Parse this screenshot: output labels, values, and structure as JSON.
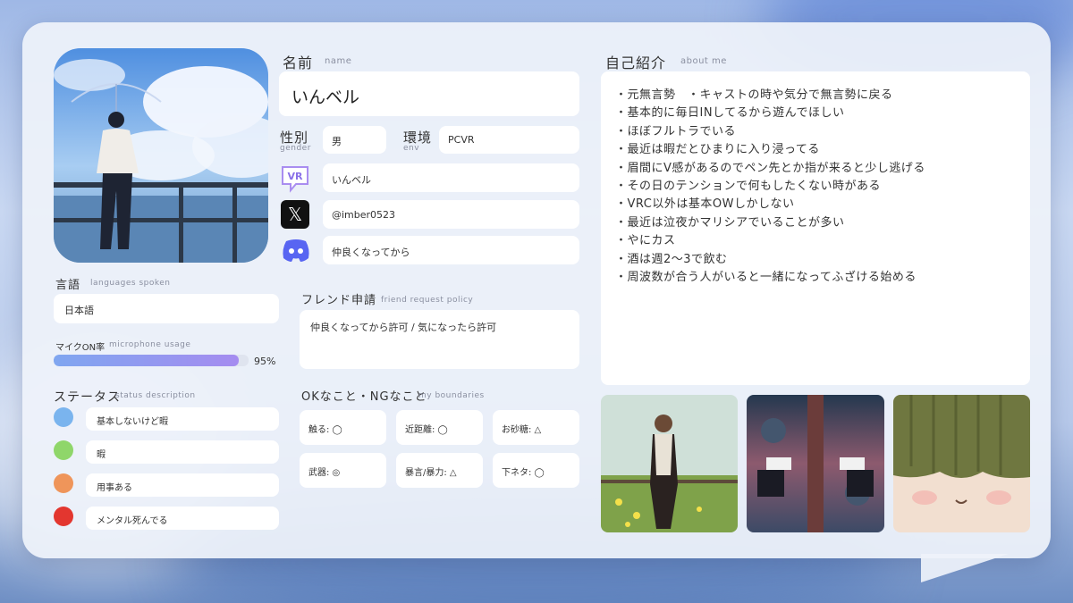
{
  "colors": {
    "status_1": "#7ab4ee",
    "status_2": "#8fd66a",
    "status_3": "#ef955a",
    "status_4": "#e3362f",
    "progress_start": "#7fa6f0",
    "progress_end": "#a58cf0"
  },
  "name": {
    "label_jp": "名前",
    "label_en": "name",
    "value": "いんベル"
  },
  "gender": {
    "label_jp": "性別",
    "label_en": "gender",
    "value": "男"
  },
  "env": {
    "label_jp": "環境",
    "label_en": "env",
    "value": "PCVR"
  },
  "socials": [
    {
      "icon": "vrchat-icon",
      "icon_text": "VR",
      "value": "いんベル"
    },
    {
      "icon": "x-icon",
      "icon_text": "𝕏",
      "value": "@imber0523"
    },
    {
      "icon": "discord-icon",
      "value": "仲良くなってから"
    }
  ],
  "languages": {
    "label_jp": "言語",
    "label_en": "languages spoken",
    "value": "日本語"
  },
  "mic": {
    "label_jp": "マイクON率",
    "label_en": "microphone usage",
    "percent": 95,
    "value_text": "95%"
  },
  "status": {
    "label_jp": "ステータス",
    "label_en": "status description",
    "items": [
      {
        "text": "基本しないけど暇"
      },
      {
        "text": "暇"
      },
      {
        "text": "用事ある"
      },
      {
        "text": "メンタル死んでる"
      }
    ]
  },
  "friend": {
    "label_jp": "フレンド申請",
    "label_en": "friend request policy",
    "value": "仲良くなってから許可 / 気になったら許可"
  },
  "boundaries": {
    "label_jp": "OKなこと・NGなこと",
    "label_en": "my boundaries",
    "items": [
      {
        "text": "触る: ◯"
      },
      {
        "text": "近距離: ◯"
      },
      {
        "text": "お砂糖: △"
      },
      {
        "text": "武器: ◎"
      },
      {
        "text": "暴言/暴力: △"
      },
      {
        "text": "下ネタ: ◯"
      }
    ]
  },
  "about": {
    "label_jp": "自己紹介",
    "label_en": "about me",
    "lines": [
      "・元無言勢　・キャストの時や気分で無言勢に戻る",
      "・基本的に毎日INしてるから遊んでほしい",
      "・ほぼフルトラでいる",
      "・最近は暇だとひまりに入り浸ってる",
      "・眉間にV感があるのでペン先とか指が来ると少し逃げる",
      "・その日のテンションで何もしたくない時がある",
      "・VRC以外は基本OWしかしない",
      "・最近は泣夜かマリシアでいることが多い",
      "・やにカス",
      "・酒は週2～3で飲む",
      "・周波数が合う人がいると一緒になってふざける始める"
    ]
  }
}
